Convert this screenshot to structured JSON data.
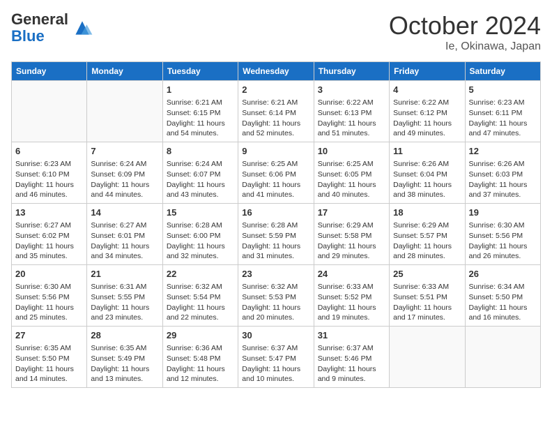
{
  "header": {
    "logo_general": "General",
    "logo_blue": "Blue",
    "month": "October 2024",
    "location": "Ie, Okinawa, Japan"
  },
  "days_of_week": [
    "Sunday",
    "Monday",
    "Tuesday",
    "Wednesday",
    "Thursday",
    "Friday",
    "Saturday"
  ],
  "weeks": [
    [
      {
        "day": "",
        "info": ""
      },
      {
        "day": "",
        "info": ""
      },
      {
        "day": "1",
        "info": "Sunrise: 6:21 AM\nSunset: 6:15 PM\nDaylight: 11 hours and 54 minutes."
      },
      {
        "day": "2",
        "info": "Sunrise: 6:21 AM\nSunset: 6:14 PM\nDaylight: 11 hours and 52 minutes."
      },
      {
        "day": "3",
        "info": "Sunrise: 6:22 AM\nSunset: 6:13 PM\nDaylight: 11 hours and 51 minutes."
      },
      {
        "day": "4",
        "info": "Sunrise: 6:22 AM\nSunset: 6:12 PM\nDaylight: 11 hours and 49 minutes."
      },
      {
        "day": "5",
        "info": "Sunrise: 6:23 AM\nSunset: 6:11 PM\nDaylight: 11 hours and 47 minutes."
      }
    ],
    [
      {
        "day": "6",
        "info": "Sunrise: 6:23 AM\nSunset: 6:10 PM\nDaylight: 11 hours and 46 minutes."
      },
      {
        "day": "7",
        "info": "Sunrise: 6:24 AM\nSunset: 6:09 PM\nDaylight: 11 hours and 44 minutes."
      },
      {
        "day": "8",
        "info": "Sunrise: 6:24 AM\nSunset: 6:07 PM\nDaylight: 11 hours and 43 minutes."
      },
      {
        "day": "9",
        "info": "Sunrise: 6:25 AM\nSunset: 6:06 PM\nDaylight: 11 hours and 41 minutes."
      },
      {
        "day": "10",
        "info": "Sunrise: 6:25 AM\nSunset: 6:05 PM\nDaylight: 11 hours and 40 minutes."
      },
      {
        "day": "11",
        "info": "Sunrise: 6:26 AM\nSunset: 6:04 PM\nDaylight: 11 hours and 38 minutes."
      },
      {
        "day": "12",
        "info": "Sunrise: 6:26 AM\nSunset: 6:03 PM\nDaylight: 11 hours and 37 minutes."
      }
    ],
    [
      {
        "day": "13",
        "info": "Sunrise: 6:27 AM\nSunset: 6:02 PM\nDaylight: 11 hours and 35 minutes."
      },
      {
        "day": "14",
        "info": "Sunrise: 6:27 AM\nSunset: 6:01 PM\nDaylight: 11 hours and 34 minutes."
      },
      {
        "day": "15",
        "info": "Sunrise: 6:28 AM\nSunset: 6:00 PM\nDaylight: 11 hours and 32 minutes."
      },
      {
        "day": "16",
        "info": "Sunrise: 6:28 AM\nSunset: 5:59 PM\nDaylight: 11 hours and 31 minutes."
      },
      {
        "day": "17",
        "info": "Sunrise: 6:29 AM\nSunset: 5:58 PM\nDaylight: 11 hours and 29 minutes."
      },
      {
        "day": "18",
        "info": "Sunrise: 6:29 AM\nSunset: 5:57 PM\nDaylight: 11 hours and 28 minutes."
      },
      {
        "day": "19",
        "info": "Sunrise: 6:30 AM\nSunset: 5:56 PM\nDaylight: 11 hours and 26 minutes."
      }
    ],
    [
      {
        "day": "20",
        "info": "Sunrise: 6:30 AM\nSunset: 5:56 PM\nDaylight: 11 hours and 25 minutes."
      },
      {
        "day": "21",
        "info": "Sunrise: 6:31 AM\nSunset: 5:55 PM\nDaylight: 11 hours and 23 minutes."
      },
      {
        "day": "22",
        "info": "Sunrise: 6:32 AM\nSunset: 5:54 PM\nDaylight: 11 hours and 22 minutes."
      },
      {
        "day": "23",
        "info": "Sunrise: 6:32 AM\nSunset: 5:53 PM\nDaylight: 11 hours and 20 minutes."
      },
      {
        "day": "24",
        "info": "Sunrise: 6:33 AM\nSunset: 5:52 PM\nDaylight: 11 hours and 19 minutes."
      },
      {
        "day": "25",
        "info": "Sunrise: 6:33 AM\nSunset: 5:51 PM\nDaylight: 11 hours and 17 minutes."
      },
      {
        "day": "26",
        "info": "Sunrise: 6:34 AM\nSunset: 5:50 PM\nDaylight: 11 hours and 16 minutes."
      }
    ],
    [
      {
        "day": "27",
        "info": "Sunrise: 6:35 AM\nSunset: 5:50 PM\nDaylight: 11 hours and 14 minutes."
      },
      {
        "day": "28",
        "info": "Sunrise: 6:35 AM\nSunset: 5:49 PM\nDaylight: 11 hours and 13 minutes."
      },
      {
        "day": "29",
        "info": "Sunrise: 6:36 AM\nSunset: 5:48 PM\nDaylight: 11 hours and 12 minutes."
      },
      {
        "day": "30",
        "info": "Sunrise: 6:37 AM\nSunset: 5:47 PM\nDaylight: 11 hours and 10 minutes."
      },
      {
        "day": "31",
        "info": "Sunrise: 6:37 AM\nSunset: 5:46 PM\nDaylight: 11 hours and 9 minutes."
      },
      {
        "day": "",
        "info": ""
      },
      {
        "day": "",
        "info": ""
      }
    ]
  ]
}
